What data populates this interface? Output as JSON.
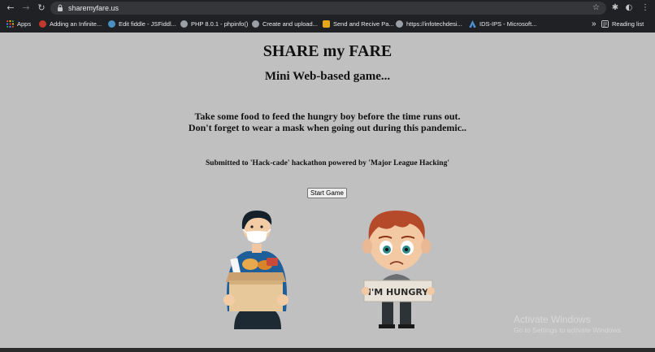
{
  "browser": {
    "url": "sharemyfare.us",
    "bookmarks": [
      {
        "label": "Apps"
      },
      {
        "label": "Adding an Infinite..."
      },
      {
        "label": "Edit fiddle - JSFiddl..."
      },
      {
        "label": "PHP 8.0.1 - phpinfo()"
      },
      {
        "label": "Create and upload..."
      },
      {
        "label": "Send and Recive Pa..."
      },
      {
        "label": "https://infotechdesi..."
      },
      {
        "label": "IDS-IPS - Microsoft..."
      }
    ],
    "overflow_label": "»",
    "reading_list": "Reading list"
  },
  "page": {
    "title": "SHARE my FARE",
    "subtitle": "Mini Web-based game...",
    "instruction_1": "Take some food to feed the hungry boy before the time runs out.",
    "instruction_2": "Don't forget to wear a mask when going out during this pandemic..",
    "credit": "Submitted to 'Hack-cade' hackathon powered by 'Major League Hacking'",
    "start_button": "Start Game",
    "sign_text": "I'M HUNGRY"
  },
  "watermark": {
    "line1": "Activate Windows",
    "line2": "Go to Settings to activate Windows."
  },
  "colors": {
    "page_bg": "#c0c0c0",
    "chrome_bg": "#202124",
    "omnibox_bg": "#35363a"
  }
}
